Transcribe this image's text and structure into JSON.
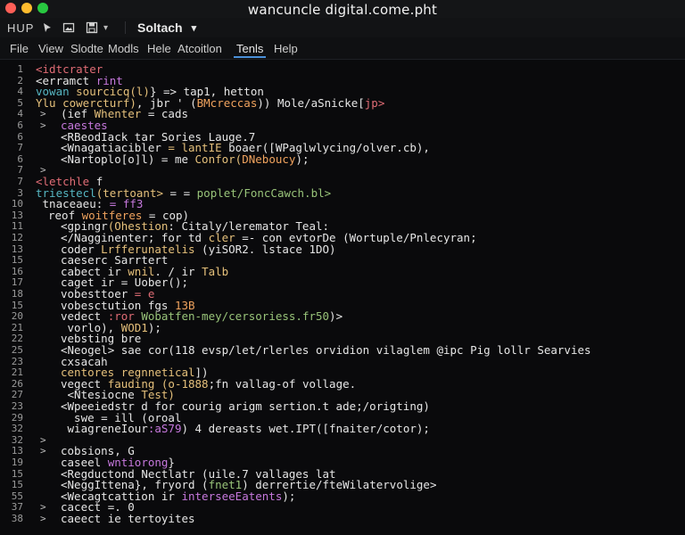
{
  "window": {
    "title": "wancuncle digital.come.pht"
  },
  "toolbar": {
    "hup": "HUP",
    "icons": [
      "pin-icon",
      "image-icon",
      "save-icon"
    ],
    "dropdown": "▾",
    "search_label": "Soltach",
    "search_caret": "▾"
  },
  "menu": [
    {
      "label": "File",
      "active": false
    },
    {
      "label": "View",
      "active": false
    },
    {
      "label": "Slodte",
      "active": false
    },
    {
      "label": "Modls",
      "active": false
    },
    {
      "label": "Hele",
      "active": false
    },
    {
      "label": "Atcoitlon",
      "active": false
    },
    {
      "label": "Tenls",
      "active": true
    },
    {
      "label": "Help",
      "active": false
    }
  ],
  "editor": {
    "lines": [
      {
        "n": "1",
        "indent": 0,
        "fold": "",
        "tokens": [
          {
            "t": "<idtcrater",
            "c": "c-red"
          }
        ]
      },
      {
        "n": "2",
        "indent": 0,
        "fold": "",
        "tokens": [
          {
            "t": "<erramct ",
            "c": "c-white"
          },
          {
            "t": "rint",
            "c": "c-purple"
          }
        ]
      },
      {
        "n": "4",
        "indent": 0,
        "fold": "",
        "tokens": [
          {
            "t": "vowan ",
            "c": "c-cyan"
          },
          {
            "t": "sourcicq(l)",
            "c": "c-yellow"
          },
          {
            "t": "} => tap1, hetton",
            "c": "c-white"
          }
        ]
      },
      {
        "n": "5",
        "indent": 0,
        "fold": "",
        "tokens": [
          {
            "t": "Ylu cowercturf)",
            "c": "c-yellow"
          },
          {
            "t": ", jbr ' (",
            "c": "c-white"
          },
          {
            "t": "BMcreccas",
            "c": "c-orange"
          },
          {
            "t": ")) ",
            "c": "c-white"
          },
          {
            "t": "Mole/aSnicke[",
            "c": "c-white"
          },
          {
            "t": "jp>",
            "c": "c-red"
          }
        ]
      },
      {
        "n": "4",
        "indent": 1,
        "fold": ">",
        "tokens": [
          {
            "t": "(ief ",
            "c": "c-white"
          },
          {
            "t": "Whenter",
            "c": "c-yellow"
          },
          {
            "t": " = cads",
            "c": "c-white"
          }
        ]
      },
      {
        "n": "6",
        "indent": 1,
        "fold": ">",
        "tokens": [
          {
            "t": "caestes",
            "c": "c-purple"
          }
        ]
      },
      {
        "n": "6",
        "indent": 2,
        "fold": "",
        "tokens": [
          {
            "t": "<RBeodIack ",
            "c": "c-white"
          },
          {
            "t": "tar Sories Lauge.7",
            "c": "c-white"
          }
        ]
      },
      {
        "n": "7",
        "indent": 2,
        "fold": "",
        "tokens": [
          {
            "t": "<Wnagatiacibler",
            "c": "c-white"
          },
          {
            "t": " = lantIE ",
            "c": "c-yellow"
          },
          {
            "t": "boaer([WPaglwlycing/",
            "c": "c-white"
          },
          {
            "t": "olver.cb",
            "c": "c-white"
          },
          {
            "t": "),",
            "c": "c-white"
          }
        ]
      },
      {
        "n": "6",
        "indent": 2,
        "fold": "",
        "tokens": [
          {
            "t": "<Nartoplo[o]l",
            "c": "c-white"
          },
          {
            "t": ") = ",
            "c": "c-white"
          },
          {
            "t": "me ",
            "c": "c-white"
          },
          {
            "t": "Confor(",
            "c": "c-yellow"
          },
          {
            "t": "DNeboucy",
            "c": "c-orange"
          },
          {
            "t": ");",
            "c": "c-white"
          }
        ]
      },
      {
        "n": "7",
        "indent": 1,
        "fold": ">",
        "tokens": [
          {
            "t": "",
            "c": "c-white"
          }
        ]
      },
      {
        "n": "7",
        "indent": 0,
        "fold": "",
        "tokens": [
          {
            "t": "<letchle ",
            "c": "c-red"
          },
          {
            "t": "f",
            "c": "c-white"
          }
        ]
      },
      {
        "n": "3",
        "indent": 0,
        "fold": "",
        "tokens": [
          {
            "t": "triestecl",
            "c": "c-cyan"
          },
          {
            "t": "(tertoant>",
            "c": "c-yellow"
          },
          {
            "t": " = = ",
            "c": "c-white"
          },
          {
            "t": "poplet/FoncCawch.bl>",
            "c": "c-green"
          }
        ]
      },
      {
        "n": "10",
        "indent": 0,
        "fold": "",
        "tokens": [
          {
            "t": " tnaceaeu:",
            "c": "c-white"
          },
          {
            "t": " = ff3",
            "c": "c-purple"
          }
        ]
      },
      {
        "n": "13",
        "indent": 1,
        "fold": "",
        "tokens": [
          {
            "t": "reof ",
            "c": "c-white"
          },
          {
            "t": "woitferes",
            "c": "c-orange"
          },
          {
            "t": " = cop)",
            "c": "c-white"
          }
        ]
      },
      {
        "n": "11",
        "indent": 2,
        "fold": "",
        "tokens": [
          {
            "t": "<gpingr",
            "c": "c-white"
          },
          {
            "t": "(Ohestion",
            "c": "c-yellow"
          },
          {
            "t": ": Citaly/leremator Teal:",
            "c": "c-white"
          }
        ]
      },
      {
        "n": "12",
        "indent": 2,
        "fold": "",
        "tokens": [
          {
            "t": "</Nagginenter",
            "c": "c-white"
          },
          {
            "t": "; for td ",
            "c": "c-white"
          },
          {
            "t": "cler",
            "c": "c-yellow"
          },
          {
            "t": " =- con evtorDe (Wortuple/Pnlecyran;",
            "c": "c-white"
          }
        ]
      },
      {
        "n": "13",
        "indent": 2,
        "fold": "",
        "tokens": [
          {
            "t": "coder ",
            "c": "c-white"
          },
          {
            "t": "Lrfferunatelis",
            "c": "c-yellow"
          },
          {
            "t": " (yiSOR2. lstace 1DO)",
            "c": "c-white"
          }
        ]
      },
      {
        "n": "15",
        "indent": 2,
        "fold": "",
        "tokens": [
          {
            "t": "caeserc ",
            "c": "c-white"
          },
          {
            "t": "Sarrtert",
            "c": "c-white"
          }
        ]
      },
      {
        "n": "16",
        "indent": 2,
        "fold": "",
        "tokens": [
          {
            "t": "cabect ir ",
            "c": "c-white"
          },
          {
            "t": "wnil",
            "c": "c-yellow"
          },
          {
            "t": ". / ir ",
            "c": "c-white"
          },
          {
            "t": "Talb",
            "c": "c-yellow"
          }
        ]
      },
      {
        "n": "17",
        "indent": 2,
        "fold": "",
        "tokens": [
          {
            "t": "caget ir = ",
            "c": "c-white"
          },
          {
            "t": "Uober();",
            "c": "c-white"
          }
        ]
      },
      {
        "n": "18",
        "indent": 2,
        "fold": "",
        "tokens": [
          {
            "t": "vobesttoer",
            "c": "c-white"
          },
          {
            "t": " = e",
            "c": "c-red"
          }
        ]
      },
      {
        "n": "15",
        "indent": 2,
        "fold": "",
        "tokens": [
          {
            "t": "vobesctution ",
            "c": "c-white"
          },
          {
            "t": "fgs ",
            "c": "c-white"
          },
          {
            "t": "13B",
            "c": "c-orange"
          }
        ]
      },
      {
        "n": "20",
        "indent": 2,
        "fold": "",
        "tokens": [
          {
            "t": "vedect ",
            "c": "c-white"
          },
          {
            "t": ":ror ",
            "c": "c-red"
          },
          {
            "t": "Wobatfen-mey/cersoriess.fr50",
            "c": "c-green"
          },
          {
            "t": ")>",
            "c": "c-white"
          }
        ]
      },
      {
        "n": "21",
        "indent": 2,
        "fold": "",
        "tokens": [
          {
            "t": " vorlo), ",
            "c": "c-white"
          },
          {
            "t": "WOD1",
            "c": "c-yellow"
          },
          {
            "t": ");",
            "c": "c-white"
          }
        ]
      },
      {
        "n": "22",
        "indent": 2,
        "fold": "",
        "tokens": [
          {
            "t": "vebsting ",
            "c": "c-white"
          },
          {
            "t": "bre",
            "c": "c-white"
          }
        ]
      },
      {
        "n": "25",
        "indent": 2,
        "fold": "",
        "tokens": [
          {
            "t": "<Neogel",
            "c": "c-white"
          },
          {
            "t": "> sae cor(118 evsp/let/rlerles orvidion vilaglem @ipc Pig lollr Searvies",
            "c": "c-white"
          }
        ]
      },
      {
        "n": "23",
        "indent": 2,
        "fold": "",
        "tokens": [
          {
            "t": "cxsacah",
            "c": "c-white"
          }
        ]
      },
      {
        "n": "21",
        "indent": 2,
        "fold": "",
        "tokens": [
          {
            "t": "centores ",
            "c": "c-yellow"
          },
          {
            "t": "regnnetical",
            "c": "c-yellow"
          },
          {
            "t": "])",
            "c": "c-white"
          }
        ]
      },
      {
        "n": "26",
        "indent": 2,
        "fold": "",
        "tokens": [
          {
            "t": "vegect ",
            "c": "c-white"
          },
          {
            "t": "fauding ",
            "c": "c-yellow"
          },
          {
            "t": "(o-1888",
            "c": "c-yellow"
          },
          {
            "t": ";fn vallag-of vollage.",
            "c": "c-white"
          }
        ]
      },
      {
        "n": "27",
        "indent": 2,
        "fold": "",
        "tokens": [
          {
            "t": " <Ntesiocne ",
            "c": "c-white"
          },
          {
            "t": "Test)",
            "c": "c-yellow"
          }
        ]
      },
      {
        "n": "23",
        "indent": 2,
        "fold": "",
        "tokens": [
          {
            "t": "<Wpeeiedstr d ",
            "c": "c-white"
          },
          {
            "t": "for courig arigm sertion.t ade;/origting)",
            "c": "c-white"
          }
        ]
      },
      {
        "n": "29",
        "indent": 2,
        "fold": "",
        "tokens": [
          {
            "t": "  swe = ill (oroal",
            "c": "c-white"
          }
        ]
      },
      {
        "n": "32",
        "indent": 2,
        "fold": "",
        "tokens": [
          {
            "t": " wiagreneIour",
            "c": "c-white"
          },
          {
            "t": ":aS79",
            "c": "c-purple"
          },
          {
            "t": ") 4 dereasts wet.IPT",
            "c": "c-white"
          },
          {
            "t": "([fnaiter/cotor);",
            "c": "c-white"
          }
        ]
      },
      {
        "n": "32",
        "indent": 1,
        "fold": ">",
        "tokens": [
          {
            "t": "",
            "c": "c-white"
          }
        ]
      },
      {
        "n": "13",
        "indent": 1,
        "fold": ">",
        "tokens": [
          {
            "t": "cobsions, G",
            "c": "c-white"
          }
        ]
      },
      {
        "n": "19",
        "indent": 2,
        "fold": "",
        "tokens": [
          {
            "t": "caseel ",
            "c": "c-white"
          },
          {
            "t": "wntiorong",
            "c": "c-purple"
          },
          {
            "t": "}",
            "c": "c-white"
          }
        ]
      },
      {
        "n": "15",
        "indent": 2,
        "fold": "",
        "tokens": [
          {
            "t": "<Regductond ",
            "c": "c-white"
          },
          {
            "t": "Nectlatr (uile.7 vallages lat",
            "c": "c-white"
          }
        ]
      },
      {
        "n": "15",
        "indent": 2,
        "fold": "",
        "tokens": [
          {
            "t": "<NeggIttena}",
            "c": "c-white"
          },
          {
            "t": ", fryord (",
            "c": "c-white"
          },
          {
            "t": "fnet1",
            "c": "c-green"
          },
          {
            "t": ") derrertie/fte",
            "c": "c-white"
          },
          {
            "t": "Wilatervolige>",
            "c": "c-white"
          }
        ]
      },
      {
        "n": "55",
        "indent": 2,
        "fold": "",
        "tokens": [
          {
            "t": "<Wecagtcattion ",
            "c": "c-white"
          },
          {
            "t": "ir ",
            "c": "c-white"
          },
          {
            "t": "interseeEatents",
            "c": "c-purple"
          },
          {
            "t": ");",
            "c": "c-white"
          }
        ]
      },
      {
        "n": "37",
        "indent": 1,
        "fold": ">",
        "tokens": [
          {
            "t": "cacect ",
            "c": "c-white"
          },
          {
            "t": "=. 0",
            "c": "c-white"
          }
        ]
      },
      {
        "n": "38",
        "indent": 1,
        "fold": ">",
        "tokens": [
          {
            "t": "caeect ",
            "c": "c-white"
          },
          {
            "t": "ie ",
            "c": "c-white"
          },
          {
            "t": "tertoyites",
            "c": "c-white"
          }
        ]
      }
    ]
  },
  "colors": {
    "background": "#0a0a0c",
    "accent": "#4a90d9"
  }
}
